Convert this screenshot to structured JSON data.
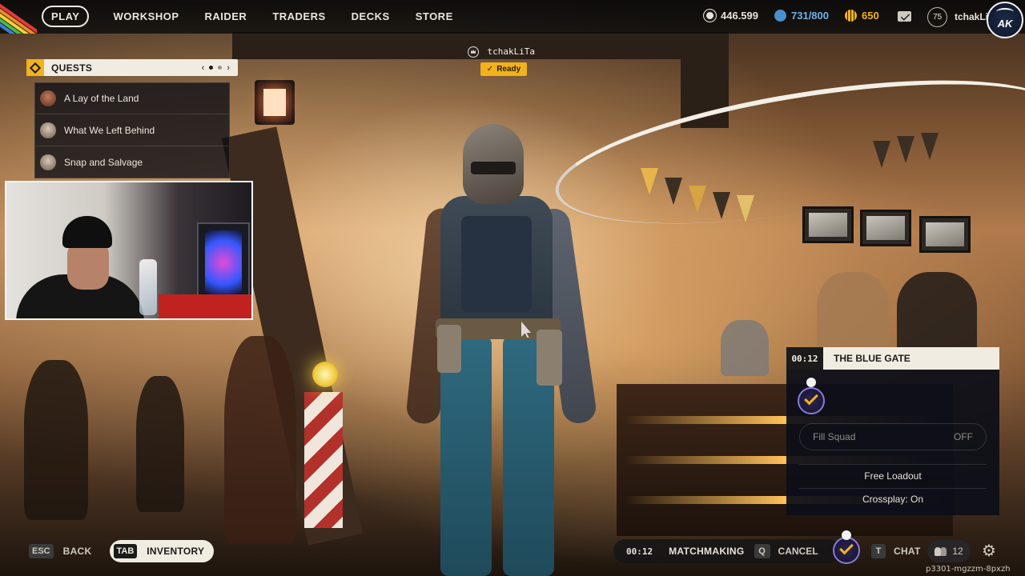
{
  "nav": {
    "items": [
      {
        "label": "PLAY",
        "active": true
      },
      {
        "label": "WORKSHOP",
        "active": false
      },
      {
        "label": "RAIDER",
        "active": false
      },
      {
        "label": "TRADERS",
        "active": false
      },
      {
        "label": "DECKS",
        "active": false
      },
      {
        "label": "STORE",
        "active": false
      }
    ]
  },
  "currencies": {
    "credits": "446.599",
    "raider_tokens": "731/800",
    "cred": "650"
  },
  "profile": {
    "level": "75",
    "username": "tchakLi",
    "avatar_text": "AK"
  },
  "quests": {
    "title": "QUESTS",
    "pager_prev": "‹",
    "pager_next": "›",
    "items": [
      {
        "label": "A Lay of the Land"
      },
      {
        "label": "What We Left Behind"
      },
      {
        "label": "Snap and Salvage"
      }
    ]
  },
  "party": {
    "player_name": "tchakLiTa",
    "ready_label": "Ready"
  },
  "matchmaking_panel": {
    "timer": "00:12",
    "map_name": "THE BLUE GATE",
    "fill_squad_label": "Fill Squad",
    "fill_squad_value": "OFF",
    "loadout": "Free Loadout",
    "crossplay": "Crossplay: On"
  },
  "bottom": {
    "back_key": "ESC",
    "back_label": "BACK",
    "inventory_key": "TAB",
    "inventory_label": "INVENTORY",
    "mm_timer": "00:12",
    "mm_label": "MATCHMAKING",
    "cancel_key": "Q",
    "cancel_label": "CANCEL",
    "chat_key": "T",
    "chat_label": "CHAT",
    "friends_count": "12",
    "session_id": "p3301-mgzzm-8pxzh"
  },
  "colors": {
    "accent_yellow": "#f2b21b",
    "panel_light": "#f1ece2",
    "panel_dark": "#0c0e18"
  }
}
